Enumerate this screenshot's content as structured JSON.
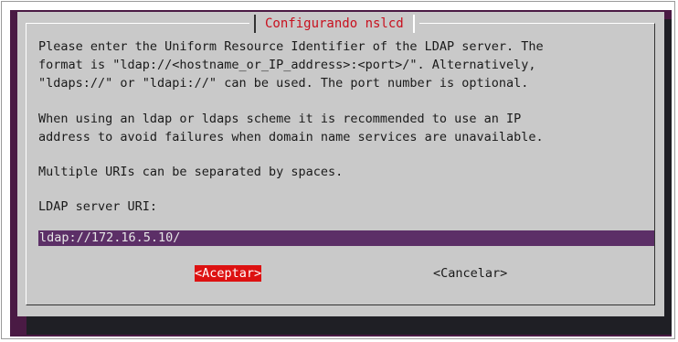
{
  "dialog": {
    "title": "Configurando nslcd",
    "paragraph1": [
      "Please enter the Uniform Resource Identifier of the LDAP server. The",
      "format is \"ldap://<hostname_or_IP_address>:<port>/\". Alternatively,",
      "\"ldaps://\" or \"ldapi://\" can be used. The port number is optional."
    ],
    "paragraph2": [
      "When using an ldap or ldaps scheme it is recommended to use an IP",
      "address to avoid failures when domain name services are unavailable."
    ],
    "paragraph3": "Multiple URIs can be separated by spaces.",
    "field_label": "LDAP server URI:",
    "field_value": "ldap://172.16.5.10/",
    "accept_label": "<Aceptar>",
    "cancel_label": "<Cancelar>"
  },
  "colors": {
    "terminal_background": "#4a1a44",
    "dialog_background": "#c9c9c9",
    "title": "#c8101e",
    "input_background": "#5c2f67",
    "selected_button": "#dd1111"
  }
}
